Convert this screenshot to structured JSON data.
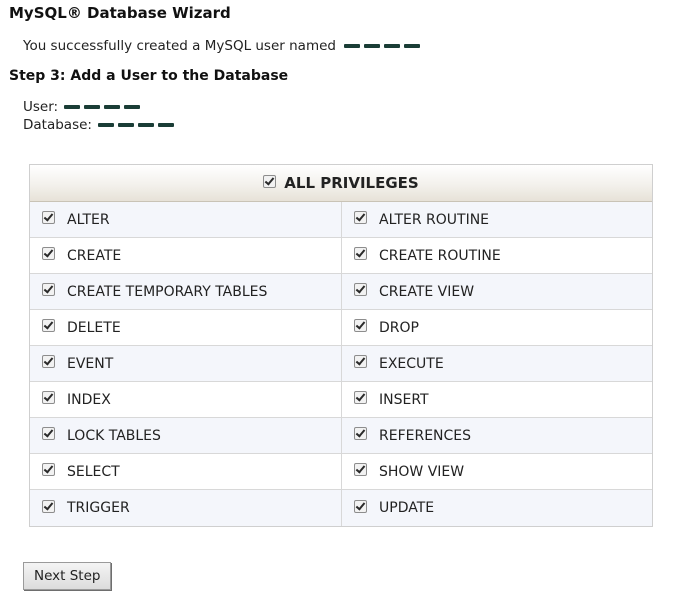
{
  "page": {
    "title": "MySQL® Database Wizard",
    "success_message": "You successfully created a MySQL user named",
    "step_title": "Step 3: Add a User to the Database",
    "user_label": "User:",
    "database_label": "Database:"
  },
  "privileges": {
    "all_label": "ALL PRIVILEGES",
    "all_checked": true,
    "rows": [
      {
        "left": "ALTER",
        "right": "ALTER ROUTINE"
      },
      {
        "left": "CREATE",
        "right": "CREATE ROUTINE"
      },
      {
        "left": "CREATE TEMPORARY TABLES",
        "right": "CREATE VIEW"
      },
      {
        "left": "DELETE",
        "right": "DROP"
      },
      {
        "left": "EVENT",
        "right": "EXECUTE"
      },
      {
        "left": "INDEX",
        "right": "INSERT"
      },
      {
        "left": "LOCK TABLES",
        "right": "REFERENCES"
      },
      {
        "left": "SELECT",
        "right": "SHOW VIEW"
      },
      {
        "left": "TRIGGER",
        "right": "UPDATE"
      }
    ]
  },
  "actions": {
    "next_label": "Next Step"
  }
}
